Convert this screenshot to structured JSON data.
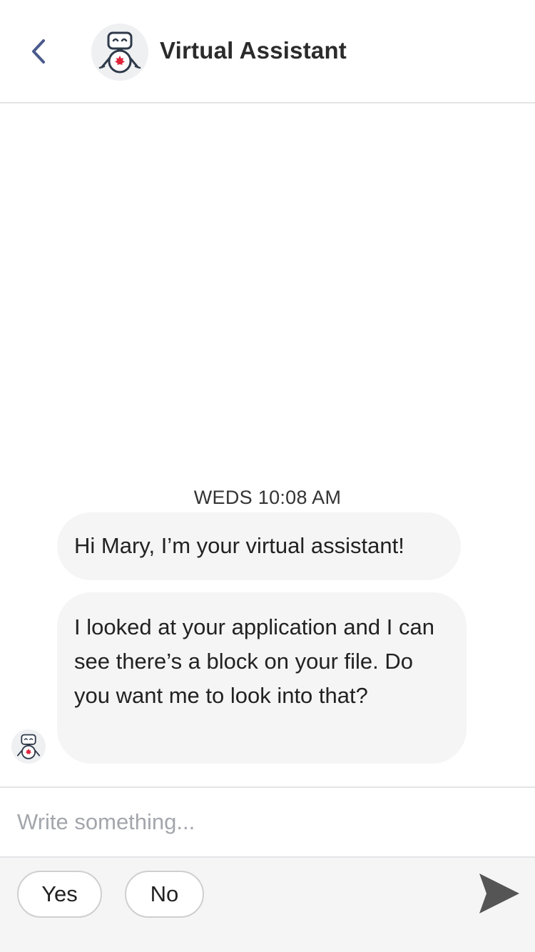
{
  "header": {
    "title": "Virtual Assistant",
    "back_icon": "chevron-left-icon",
    "avatar_icon": "robot-icon"
  },
  "chat": {
    "timestamp": "WEDS 10:08 AM",
    "messages": [
      {
        "sender": "assistant",
        "text": "Hi Mary, I’m your virtual assistant!"
      },
      {
        "sender": "assistant",
        "text": "I looked at your application and I can see there’s a block on your file. Do you want me to look into that?"
      }
    ]
  },
  "composer": {
    "placeholder": "Write something...",
    "value": "",
    "send_icon": "send-icon"
  },
  "quick_replies": [
    {
      "label": "Yes"
    },
    {
      "label": "No"
    }
  ],
  "colors": {
    "accent": "#4a5a8c",
    "robot_dark": "#2f3a4a",
    "maple_red": "#e0243a",
    "bubble_bg": "#f5f5f6",
    "send_icon": "#555555"
  }
}
